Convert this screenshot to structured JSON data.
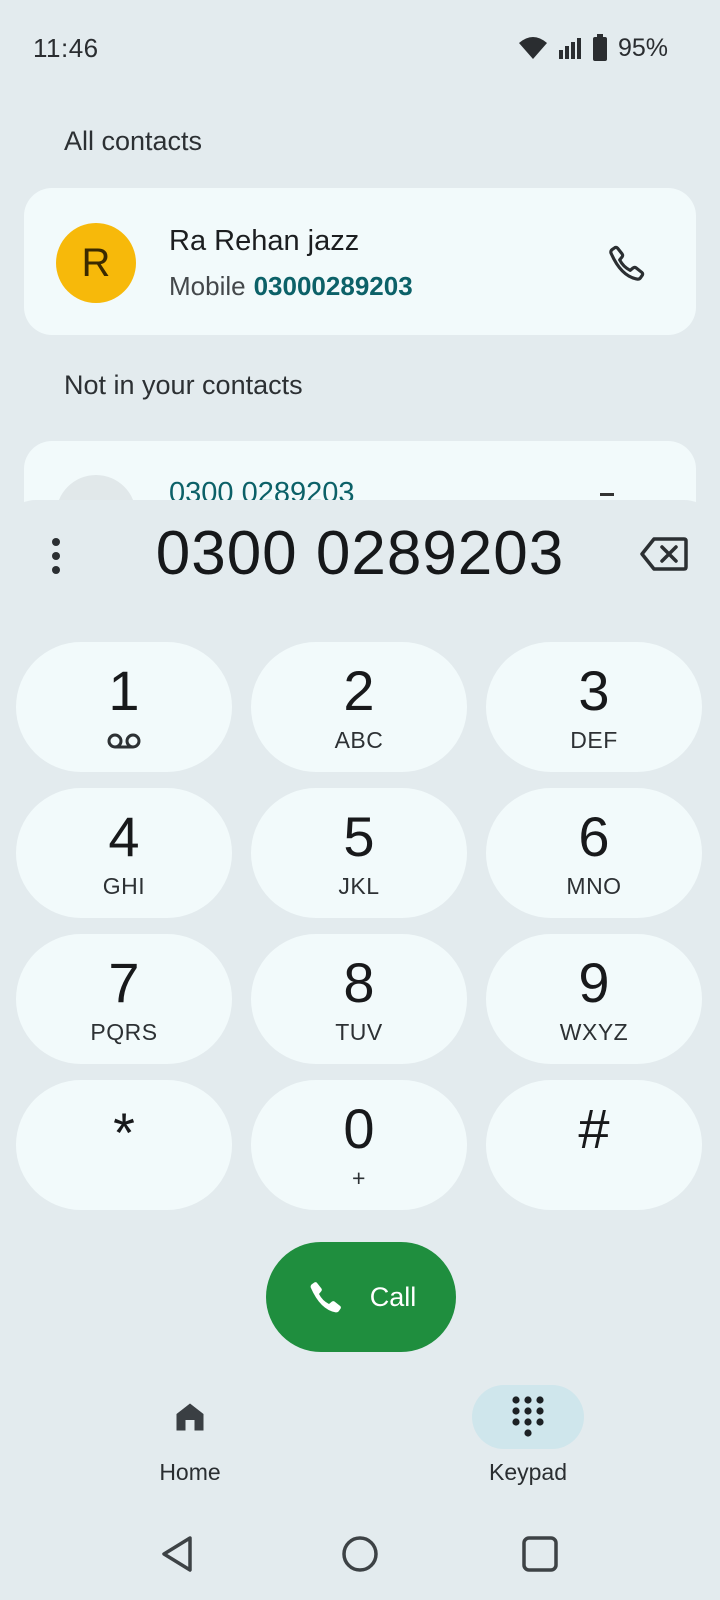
{
  "status": {
    "time": "11:46",
    "battery": "95%"
  },
  "sections": {
    "all_contacts": "All contacts",
    "not_in_contacts": "Not in your contacts"
  },
  "contact": {
    "initial": "R",
    "name": "Ra Rehan jazz",
    "type": "Mobile",
    "number": "03000289203"
  },
  "unknown": {
    "number": "0300 0289203"
  },
  "dialer": {
    "entered_number": "0300 0289203"
  },
  "keys": [
    {
      "digit": "1",
      "letters": ""
    },
    {
      "digit": "2",
      "letters": "ABC"
    },
    {
      "digit": "3",
      "letters": "DEF"
    },
    {
      "digit": "4",
      "letters": "GHI"
    },
    {
      "digit": "5",
      "letters": "JKL"
    },
    {
      "digit": "6",
      "letters": "MNO"
    },
    {
      "digit": "7",
      "letters": "PQRS"
    },
    {
      "digit": "8",
      "letters": "TUV"
    },
    {
      "digit": "9",
      "letters": "WXYZ"
    },
    {
      "digit": "*",
      "letters": ""
    },
    {
      "digit": "0",
      "letters": "+"
    },
    {
      "digit": "#",
      "letters": ""
    }
  ],
  "call_button": {
    "label": "Call"
  },
  "nav": {
    "home": "Home",
    "keypad": "Keypad"
  },
  "colors": {
    "accent_green": "#1f8e3e",
    "link_teal": "#0c6168",
    "avatar_yellow": "#f7b90a"
  }
}
